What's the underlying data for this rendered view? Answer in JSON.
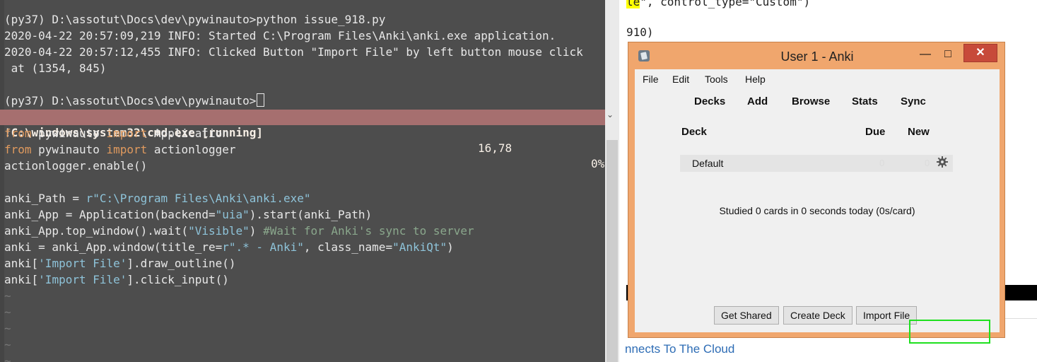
{
  "terminal": {
    "lines": [
      "(py37) D:\\assotut\\Docs\\dev\\pywinauto>python issue_918.py",
      "2020-04-22 20:57:09,219 INFO: Started C:\\Program Files\\Anki\\anki.exe application.",
      "2020-04-22 20:57:12,455 INFO: Clicked Button \"Import File\" by left button mouse click",
      " at (1354, 845)",
      "(py37) D:\\assotut\\Docs\\dev\\pywinauto>"
    ]
  },
  "vim": {
    "status_left": "!C:\\windows\\system32\\cmd.exe [running]",
    "status_pos": "16,78",
    "status_pct": "0%",
    "code": {
      "l1_kw1": "from",
      "l1_mod": " pywinauto ",
      "l1_kw2": "import",
      "l1_name": " Application",
      "l2_kw1": "from",
      "l2_mod": " pywinauto ",
      "l2_kw2": "import",
      "l2_name": " actionlogger",
      "l3": "actionlogger.enable()",
      "l5_a": "anki_Path = ",
      "l5_str": "r\"C:\\Program Files\\Anki\\anki.exe\"",
      "l6_a": "anki_App = Application(backend=",
      "l6_str": "\"uia\"",
      "l6_b": ").start(anki_Path)",
      "l7_a": "anki_App.top_window().wait(",
      "l7_str": "\"Visible\"",
      "l7_b": ") ",
      "l7_cmt": "#Wait for Anki's sync to server",
      "l8_a": "anki = anki_App.window(title_re=",
      "l8_str1": "r\".* - Anki\"",
      "l8_b": ", class_name=",
      "l8_str2": "\"AnkiQt\"",
      "l8_c": ")",
      "l9_a": "anki[",
      "l9_str": "'Import File'",
      "l9_b": "].draw_outline()",
      "l10_a": "anki[",
      "l10_str": "'Import File'",
      "l10_b": "].click_input()"
    },
    "tilde": "~"
  },
  "background_doc": {
    "frag1_hl": "le",
    "frag1_rest": "\", control_type=\"Custom\")",
    "frag2": "910)",
    "link": "nnects To The Cloud"
  },
  "anki": {
    "title": "User 1 - Anki",
    "menu": [
      "File",
      "Edit",
      "Tools",
      "Help"
    ],
    "toolbar": [
      "Decks",
      "Add",
      "Browse",
      "Stats",
      "Sync"
    ],
    "columns": {
      "deck": "Deck",
      "due": "Due",
      "new": "New"
    },
    "deck_row": {
      "name": "Default",
      "due": "0",
      "new": "0"
    },
    "studied": "Studied 0 cards in 0 seconds today (0s/card)",
    "buttons": {
      "get_shared": "Get Shared",
      "create_deck": "Create Deck",
      "import_file": "Import File"
    }
  },
  "colors": {
    "terminal_bg": "#4d4d4d",
    "statusline_bg": "#a66f6f",
    "anki_frame": "#f0a66d",
    "close_btn": "#c74a3a",
    "outline": "#1ee01e"
  }
}
